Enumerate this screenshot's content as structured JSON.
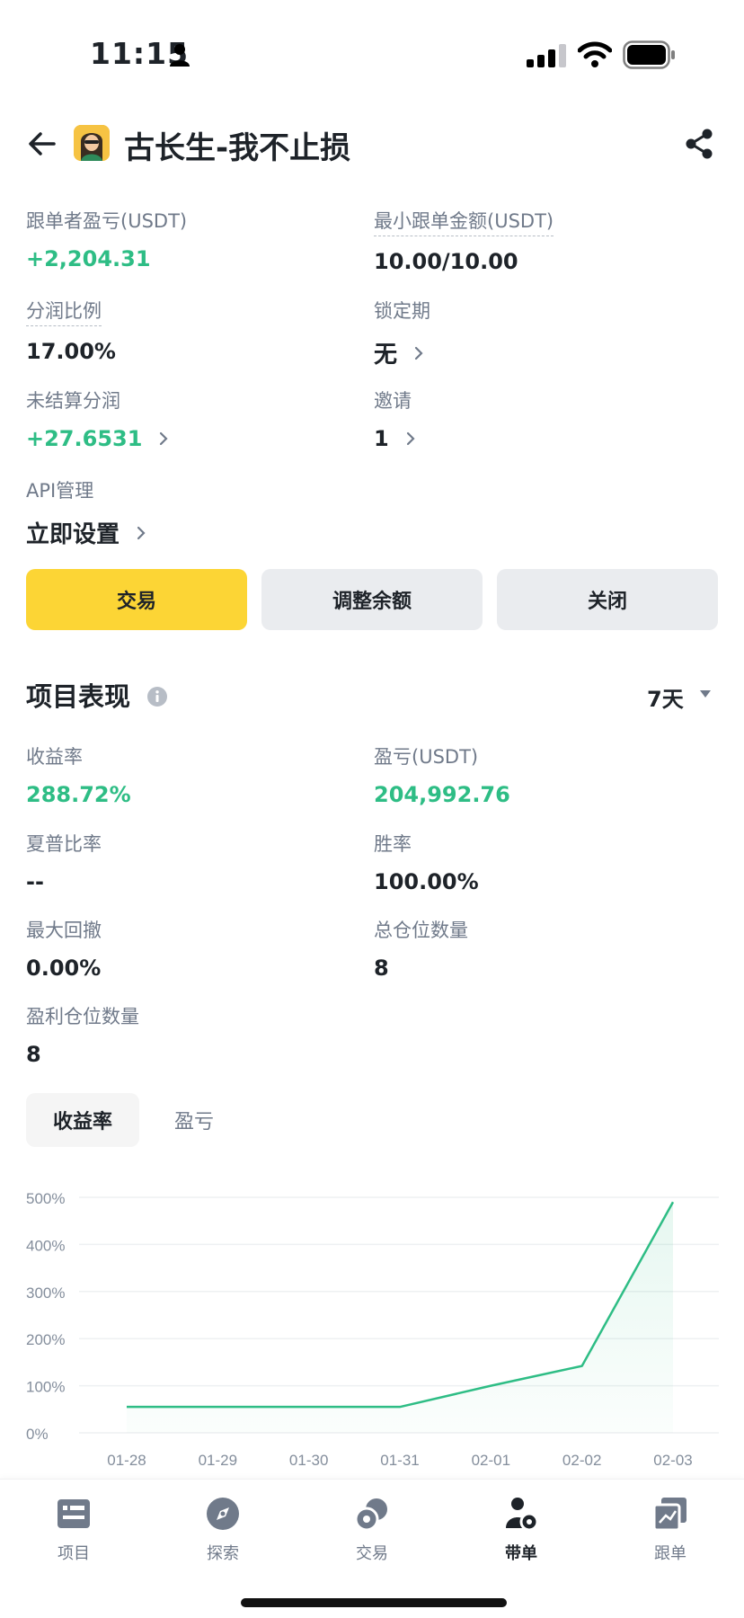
{
  "status_bar": {
    "time": "11:15"
  },
  "header": {
    "title": "古长生-我不止损"
  },
  "info": {
    "follower_pnl_label": "跟单者盈亏(USDT)",
    "follower_pnl_value": "+2,204.31",
    "min_amount_label": "最小跟单金额(USDT)",
    "min_amount_value": "10.00/10.00",
    "profit_share_label": "分润比例",
    "profit_share_value": "17.00%",
    "lock_period_label": "锁定期",
    "lock_period_value": "无",
    "unsettled_label": "未结算分润",
    "unsettled_value": "+27.6531",
    "invite_label": "邀请",
    "invite_value": "1",
    "api_label": "API管理",
    "api_value": "立即设置"
  },
  "actions": {
    "trade": "交易",
    "adjust": "调整余额",
    "close": "关闭"
  },
  "performance": {
    "title": "项目表现",
    "period": "7天",
    "roi_label": "收益率",
    "roi_value": "288.72%",
    "pnl_label": "盈亏(USDT)",
    "pnl_value": "204,992.76",
    "sharpe_label": "夏普比率",
    "sharpe_value": "--",
    "winrate_label": "胜率",
    "winrate_value": "100.00%",
    "mdd_label": "最大回撤",
    "mdd_value": "0.00%",
    "total_pos_label": "总仓位数量",
    "total_pos_value": "8",
    "win_pos_label": "盈利仓位数量",
    "win_pos_value": "8"
  },
  "chart_tabs": {
    "roi": "收益率",
    "pnl": "盈亏"
  },
  "chart_data": {
    "type": "area",
    "x": [
      "01-28",
      "01-29",
      "01-30",
      "01-31",
      "02-01",
      "02-02",
      "02-03"
    ],
    "y_ticks": [
      "500%",
      "400%",
      "300%",
      "200%",
      "100%",
      "0%"
    ],
    "ylim": [
      0,
      500
    ],
    "series": [
      {
        "values": [
          55,
          55,
          55,
          55,
          100,
          142,
          490
        ]
      }
    ],
    "grid": true,
    "line_color": "#2ebd85"
  },
  "nav": {
    "items": [
      {
        "label": "项目",
        "icon": "list-icon"
      },
      {
        "label": "探索",
        "icon": "compass-icon"
      },
      {
        "label": "交易",
        "icon": "trade-icon"
      },
      {
        "label": "带单",
        "icon": "lead-trader-icon"
      },
      {
        "label": "跟单",
        "icon": "copy-trade-icon"
      }
    ],
    "active_index": 3
  },
  "colors": {
    "green": "#2ebd85",
    "yellow": "#fcd535",
    "gray": "#eaecef",
    "text": "#1e2329",
    "secondary": "#707a8a"
  }
}
